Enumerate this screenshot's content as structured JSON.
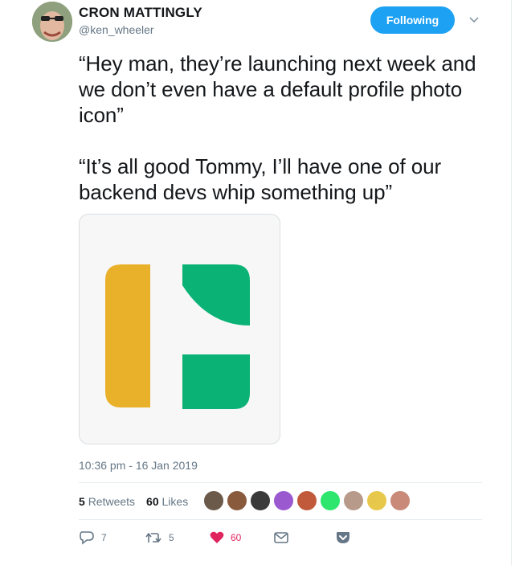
{
  "author": {
    "display_name": "CRON MATTINGLY",
    "handle": "@ken_wheeler"
  },
  "follow_button": {
    "label": "Following",
    "color": "#1da1f2"
  },
  "tweet": {
    "text": "“Hey man, they’re launching next week and we don’t even have a default profile photo icon”\n\n“It’s all good Tommy, I’ll have one of our backend devs whip something up”",
    "timestamp": "10:36 pm - 16 Jan 2019"
  },
  "media": {
    "logo_colors": {
      "bar": "#e9b02a",
      "shapes": "#0ab275"
    }
  },
  "stats": {
    "retweets_count": "5",
    "retweets_label": "Retweets",
    "likes_count": "60",
    "likes_label": "Likes"
  },
  "likers": [
    {
      "icon": "avatar",
      "color": "#6b5a4a"
    },
    {
      "icon": "avatar",
      "color": "#8a5a3c"
    },
    {
      "icon": "avatar",
      "color": "#3a3a3a"
    },
    {
      "icon": "avatar",
      "color": "#9b59d0"
    },
    {
      "icon": "avatar",
      "color": "#c05a3a"
    },
    {
      "icon": "avatar",
      "color": "#2ee66e"
    },
    {
      "icon": "avatar",
      "color": "#b89a8a"
    },
    {
      "icon": "avatar",
      "color": "#e8c84a"
    },
    {
      "icon": "avatar",
      "color": "#c98a7a"
    }
  ],
  "actions": {
    "reply_count": "7",
    "retweet_count": "5",
    "like_count": "60"
  }
}
